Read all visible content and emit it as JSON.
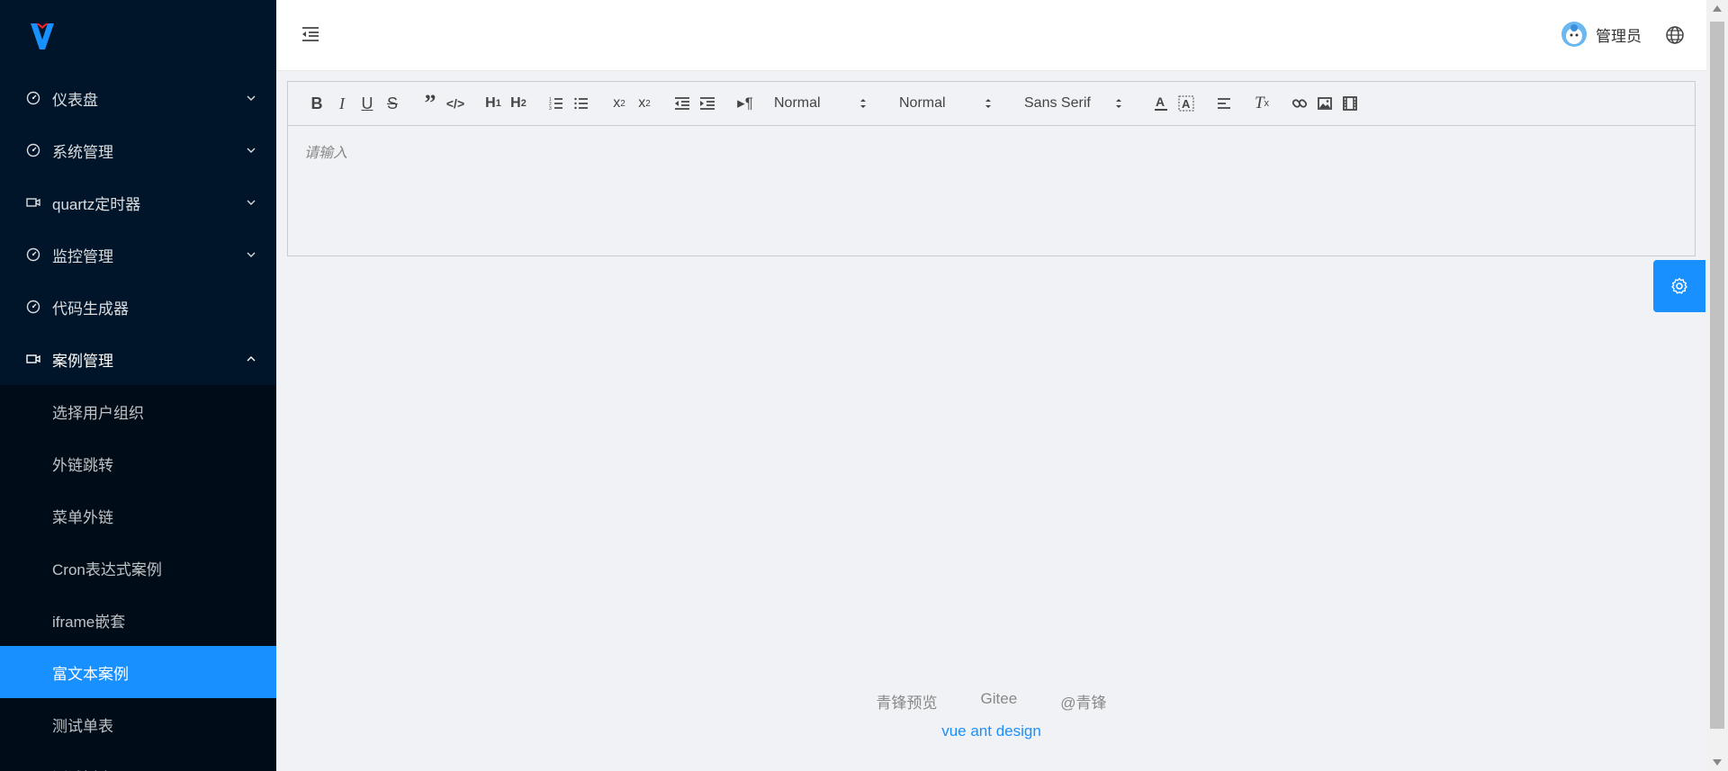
{
  "sidebar": {
    "menu": [
      {
        "label": "仪表盘",
        "icon": "dashboard-icon",
        "expanded": false
      },
      {
        "label": "系统管理",
        "icon": "dashboard-icon",
        "expanded": false
      },
      {
        "label": "quartz定时器",
        "icon": "video-camera-icon",
        "expanded": false
      },
      {
        "label": "监控管理",
        "icon": "dashboard-icon",
        "expanded": false
      },
      {
        "label": "代码生成器",
        "icon": "dashboard-icon",
        "expanded": false
      },
      {
        "label": "案例管理",
        "icon": "video-camera-icon",
        "expanded": true
      }
    ],
    "submenu": [
      {
        "label": "选择用户组织"
      },
      {
        "label": "外链跳转"
      },
      {
        "label": "菜单外链"
      },
      {
        "label": "Cron表达式案例"
      },
      {
        "label": "iframe嵌套"
      },
      {
        "label": "富文本案例",
        "active": true
      },
      {
        "label": "测试单表"
      },
      {
        "label": "测试树表"
      }
    ]
  },
  "header": {
    "username": "管理员"
  },
  "editor": {
    "header_select": "Normal",
    "size_select": "Normal",
    "font_select": "Sans Serif",
    "placeholder": "请输入"
  },
  "footer": {
    "links": [
      "青锋预览",
      "Gitee",
      "@青锋"
    ],
    "copyright": "vue ant design"
  },
  "colors": {
    "sidebar_bg": "#001529",
    "submenu_bg": "#000c17",
    "accent": "#1890ff",
    "page_bg": "#f0f2f5"
  }
}
